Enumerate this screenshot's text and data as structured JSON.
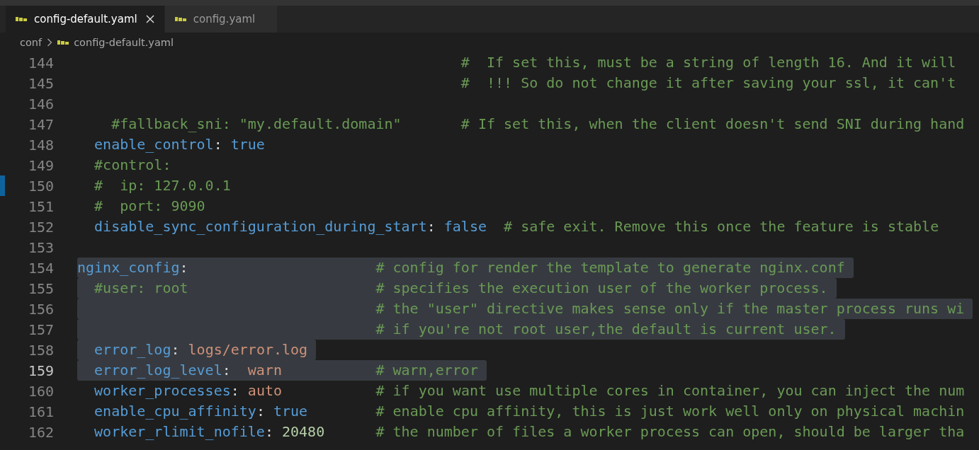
{
  "tabs": [
    {
      "label": "config-default.yaml",
      "selected": true
    },
    {
      "label": "config.yaml",
      "selected": false
    }
  ],
  "breadcrumb": {
    "folder": "conf",
    "file": "config-default.yaml"
  },
  "lines": [
    {
      "number": "144",
      "selected": false,
      "current": false,
      "tokens": [
        {
          "kind": "comment",
          "text": "                                             #  If set this, must be a string of length 16. And it will"
        }
      ]
    },
    {
      "number": "145",
      "selected": false,
      "current": false,
      "tokens": [
        {
          "kind": "comment",
          "text": "                                             #  !!! So do not change it after saving your ssl, it can't"
        }
      ]
    },
    {
      "number": "146",
      "selected": false,
      "current": false
    },
    {
      "number": "147",
      "selected": false,
      "current": false,
      "tokens": [
        {
          "kind": "comment",
          "text": "    #fallback_sni: \"my.default.domain\"       # If set this, when the client doesn't send SNI during hand"
        }
      ]
    },
    {
      "number": "148",
      "selected": false,
      "current": false,
      "tokens": [
        {
          "kind": "key",
          "text": "  enable_control"
        },
        {
          "kind": "punct",
          "text": ": "
        },
        {
          "kind": "bool",
          "text": "true"
        }
      ]
    },
    {
      "number": "149",
      "selected": false,
      "current": false,
      "tokens": [
        {
          "kind": "comment",
          "text": "  #control:"
        }
      ]
    },
    {
      "number": "150",
      "selected": false,
      "current": false,
      "tokens": [
        {
          "kind": "comment",
          "text": "  #  ip: 127.0.0.1"
        }
      ]
    },
    {
      "number": "151",
      "selected": false,
      "current": false,
      "tokens": [
        {
          "kind": "comment",
          "text": "  #  port: 9090"
        }
      ]
    },
    {
      "number": "152",
      "selected": false,
      "current": false,
      "tokens": [
        {
          "kind": "key",
          "text": "  disable_sync_configuration_during_start"
        },
        {
          "kind": "punct",
          "text": ": "
        },
        {
          "kind": "bool",
          "text": "false"
        },
        {
          "kind": "comment",
          "text": "  # safe exit. Remove this once the feature is stable"
        }
      ]
    },
    {
      "number": "153",
      "selected": false,
      "current": false
    },
    {
      "number": "154",
      "selected": true,
      "current": false,
      "tokens": [
        {
          "kind": "key",
          "text": "nginx_config"
        },
        {
          "kind": "punct",
          "text": ":                      "
        },
        {
          "kind": "comment",
          "text": "# config for render the template to generate nginx.conf"
        }
      ]
    },
    {
      "number": "155",
      "selected": true,
      "current": false,
      "tokens": [
        {
          "kind": "comment",
          "text": "  #user: root                      # specifies the execution user of the worker process."
        }
      ]
    },
    {
      "number": "156",
      "selected": true,
      "current": false,
      "tokens": [
        {
          "kind": "comment",
          "text": "                                   # the \"user\" directive makes sense only if the master process runs wi"
        }
      ]
    },
    {
      "number": "157",
      "selected": true,
      "current": false,
      "tokens": [
        {
          "kind": "comment",
          "text": "                                   # if you're not root user,the default is current user."
        }
      ]
    },
    {
      "number": "158",
      "selected": true,
      "current": false,
      "tokens": [
        {
          "kind": "key",
          "text": "  error_log"
        },
        {
          "kind": "punct",
          "text": ": "
        },
        {
          "kind": "string",
          "text": "logs/error.log"
        }
      ]
    },
    {
      "number": "159",
      "selected": true,
      "current": true,
      "tokens": [
        {
          "kind": "key",
          "text": "  error_log_level"
        },
        {
          "kind": "punct",
          "text": ":  "
        },
        {
          "kind": "string",
          "text": "warn           "
        },
        {
          "kind": "comment",
          "text": "# warn,error"
        }
      ]
    },
    {
      "number": "160",
      "selected": false,
      "current": false,
      "tokens": [
        {
          "kind": "key",
          "text": "  worker_processes"
        },
        {
          "kind": "punct",
          "text": ": "
        },
        {
          "kind": "string",
          "text": "auto           "
        },
        {
          "kind": "comment",
          "text": "# if you want use multiple cores in container, you can inject the num"
        }
      ]
    },
    {
      "number": "161",
      "selected": false,
      "current": false,
      "tokens": [
        {
          "kind": "key",
          "text": "  enable_cpu_affinity"
        },
        {
          "kind": "punct",
          "text": ": "
        },
        {
          "kind": "bool",
          "text": "true        "
        },
        {
          "kind": "comment",
          "text": "# enable cpu affinity, this is just work well only on physical machin"
        }
      ]
    },
    {
      "number": "162",
      "selected": false,
      "current": false,
      "tokens": [
        {
          "kind": "key",
          "text": "  worker_rlimit_nofile"
        },
        {
          "kind": "punct",
          "text": ": "
        },
        {
          "kind": "number",
          "text": "20480      "
        },
        {
          "kind": "comment",
          "text": "# the number of files a worker process can open, should be larger tha"
        }
      ]
    }
  ]
}
